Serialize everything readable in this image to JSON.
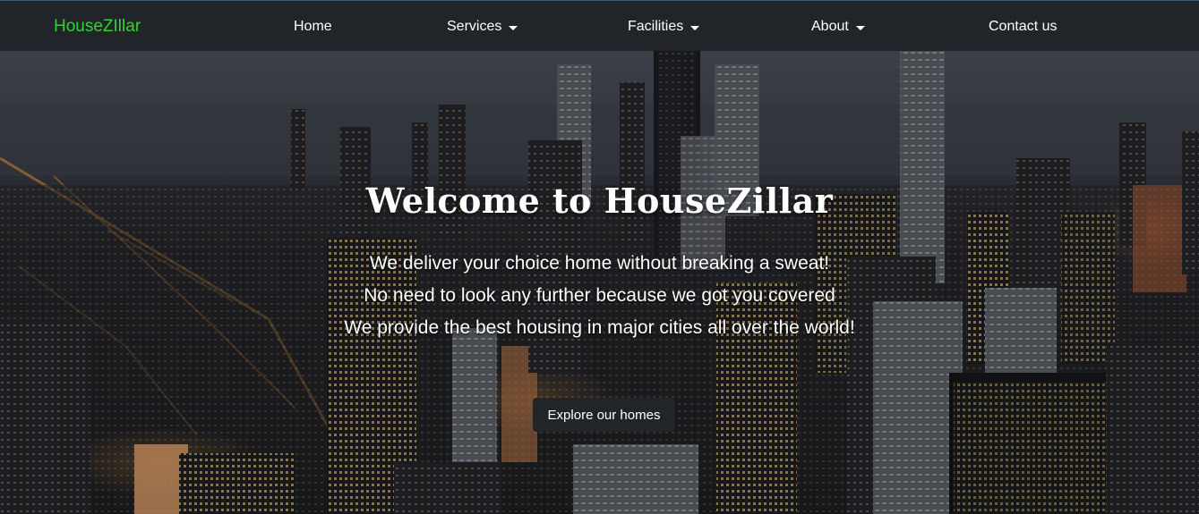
{
  "navbar": {
    "brand": "HouseZIllar",
    "items": [
      {
        "label": "Home",
        "dropdown": false
      },
      {
        "label": "Services",
        "dropdown": true
      },
      {
        "label": "Facilities",
        "dropdown": true
      },
      {
        "label": "About",
        "dropdown": true
      },
      {
        "label": "Contact us",
        "dropdown": false
      }
    ]
  },
  "hero": {
    "title": "Welcome to HouseZillar",
    "lines": [
      "We deliver your choice home without breaking a sweat!",
      "No need to look any further because we got you covered",
      "We provide the best housing in major cities all over the world!"
    ],
    "button_label": "Explore our homes"
  },
  "colors": {
    "navbar_bg": "#212529",
    "brand": "#2fd42f",
    "button_bg": "#212529",
    "text": "#ffffff"
  }
}
